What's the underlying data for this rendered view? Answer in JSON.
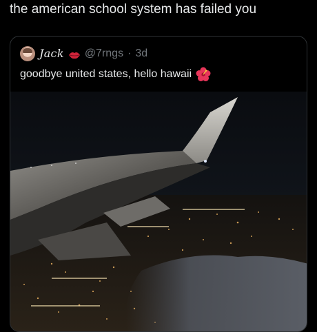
{
  "post": {
    "text": "the american school system has failed you"
  },
  "quote": {
    "display_name": "Jack",
    "handle": "@7rngs",
    "separator": "·",
    "age": "3d",
    "text": "goodbye united states, hello hawaii",
    "emoji_icon": "hibiscus-icon",
    "name_badge_icon": "lips-icon"
  },
  "media": {
    "description_icon": "airplane-wing-night-photo"
  },
  "colors": {
    "background": "#000000",
    "text_primary": "#e7e9ea",
    "text_secondary": "#71767b",
    "border": "#2f3336"
  }
}
